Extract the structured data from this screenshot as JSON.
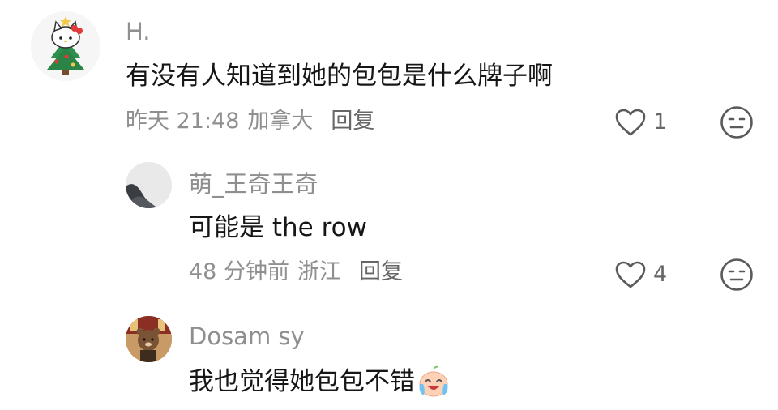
{
  "comments": [
    {
      "username": "H.",
      "text": "有没有人知道到她的包包是什么牌子啊",
      "time": "昨天 21:48",
      "location": "加拿大",
      "reply_label": "回复",
      "likes": "1",
      "avatar_icon": "hello-kitty-christmas-tree-avatar"
    },
    {
      "username": "萌_王奇王奇",
      "text": "可能是 the row",
      "time": "48 分钟前",
      "location": "浙江",
      "reply_label": "回复",
      "likes": "4",
      "avatar_icon": "person-silhouette-avatar"
    },
    {
      "username": "Dosam sy",
      "text": "我也觉得她包包不错",
      "emoji": "crying-laughing-emoji",
      "avatar_icon": "bear-avatar"
    }
  ],
  "icons": {
    "like": "heart-outline-icon",
    "react": "neutral-face-icon"
  }
}
